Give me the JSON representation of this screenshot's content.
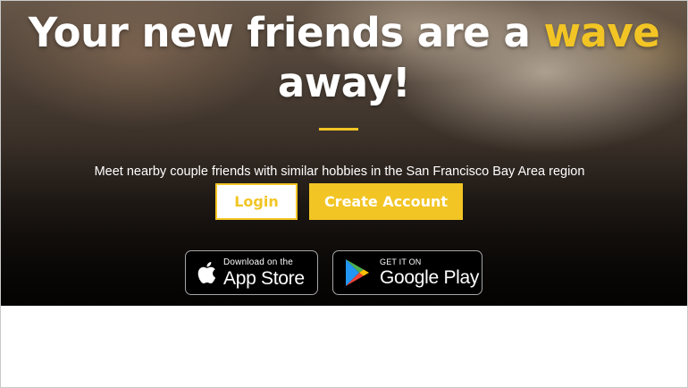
{
  "hero": {
    "headline_part1": "Your new friends are a ",
    "headline_accent": "wave",
    "headline_part2": "away!",
    "tagline": "Meet nearby couple friends with similar hobbies in the San Francisco Bay Area region",
    "accent_color": "#f2c524"
  },
  "actions": {
    "login_label": "Login",
    "create_account_label": "Create Account"
  },
  "stores": {
    "apple": {
      "small": "Download on the",
      "big": "App Store",
      "icon": "apple-icon"
    },
    "google": {
      "small": "GET IT ON",
      "big": "Google Play",
      "icon": "google-play-icon"
    }
  }
}
